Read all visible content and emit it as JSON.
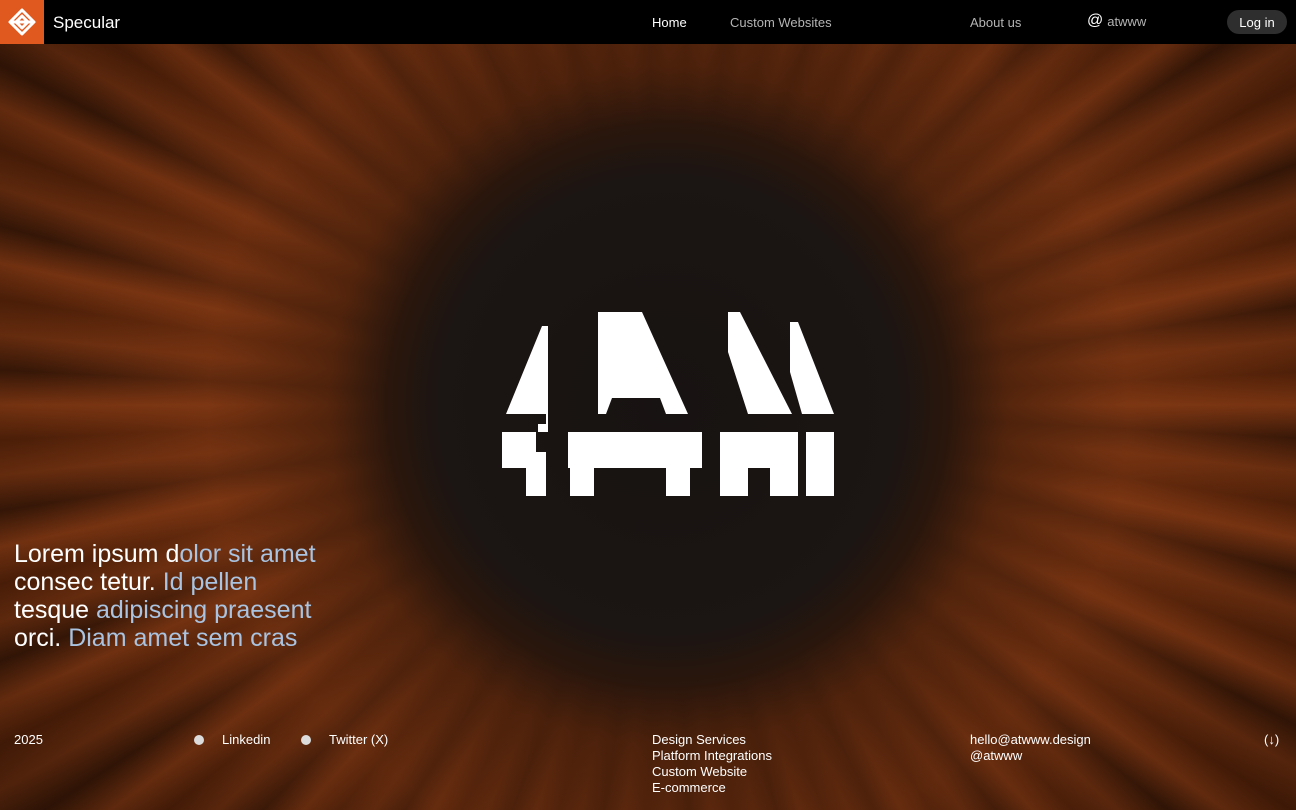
{
  "brand": {
    "name": "Specular",
    "logo": "diamond-knot-logo-icon",
    "accent_color": "#e0591f"
  },
  "nav": {
    "home": "Home",
    "custom_websites": "Custom Websites",
    "about": "About us",
    "handle": "atwww",
    "handle_icon": "at-icon",
    "login": "Log in"
  },
  "hero": {
    "mark": "ATW-monogram-logo",
    "tagline_plain_1": "Lorem ipsum d",
    "tagline_accent_1": "olor sit amet",
    "tagline_plain_2": "consec tetur. ",
    "tagline_accent_2": "Id pellen",
    "tagline_plain_3": "tesque ",
    "tagline_accent_3": "adipiscing praesent",
    "tagline_plain_4": "orci. ",
    "tagline_accent_4": "Diam amet sem cras",
    "accent_color": "#a9c3e0"
  },
  "footer": {
    "year": "2025",
    "social": [
      "Linkedin",
      "Twitter (X)"
    ],
    "services": [
      "Design Services",
      "Platform Integrations",
      "Custom Website",
      "E-commerce"
    ],
    "contact": [
      "hello@atwww.design",
      "@atwww"
    ],
    "scroll": "(↓)"
  }
}
